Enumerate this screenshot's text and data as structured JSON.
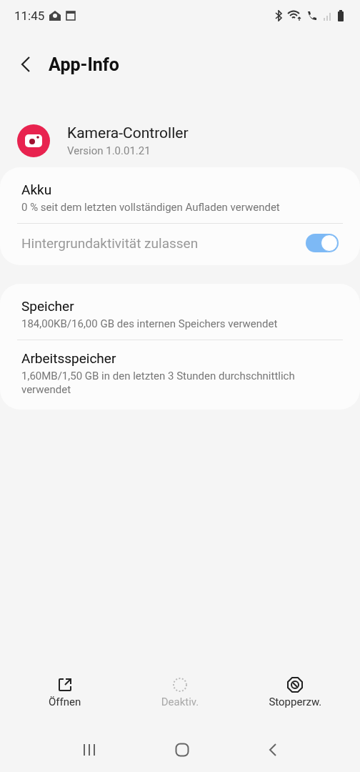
{
  "status_bar": {
    "time": "11:45"
  },
  "header": {
    "title": "App-Info"
  },
  "app": {
    "name": "Kamera-Controller",
    "version": "Version 1.0.01.21"
  },
  "cards": [
    {
      "items": [
        {
          "kind": "info",
          "title": "Akku",
          "subtitle": "0 % seit dem letzten vollständigen Aufladen verwendet"
        },
        {
          "kind": "toggle",
          "title": "Hintergrundaktivität zulassen",
          "on": true,
          "disabled": true
        }
      ]
    },
    {
      "items": [
        {
          "kind": "info",
          "title": "Speicher",
          "subtitle": "184,00KB/16,00 GB des internen Speichers verwendet"
        },
        {
          "kind": "info",
          "title": "Arbeitsspeicher",
          "subtitle": "1,60MB/1,50 GB in den letzten 3 Stunden durchschnittlich verwendet"
        }
      ]
    }
  ],
  "actions": [
    {
      "kind": "open",
      "label": "Öffnen",
      "disabled": false
    },
    {
      "kind": "deactivate",
      "label": "Deaktiv.",
      "disabled": true
    },
    {
      "kind": "stop",
      "label": "Stopperzw.",
      "disabled": false
    }
  ]
}
